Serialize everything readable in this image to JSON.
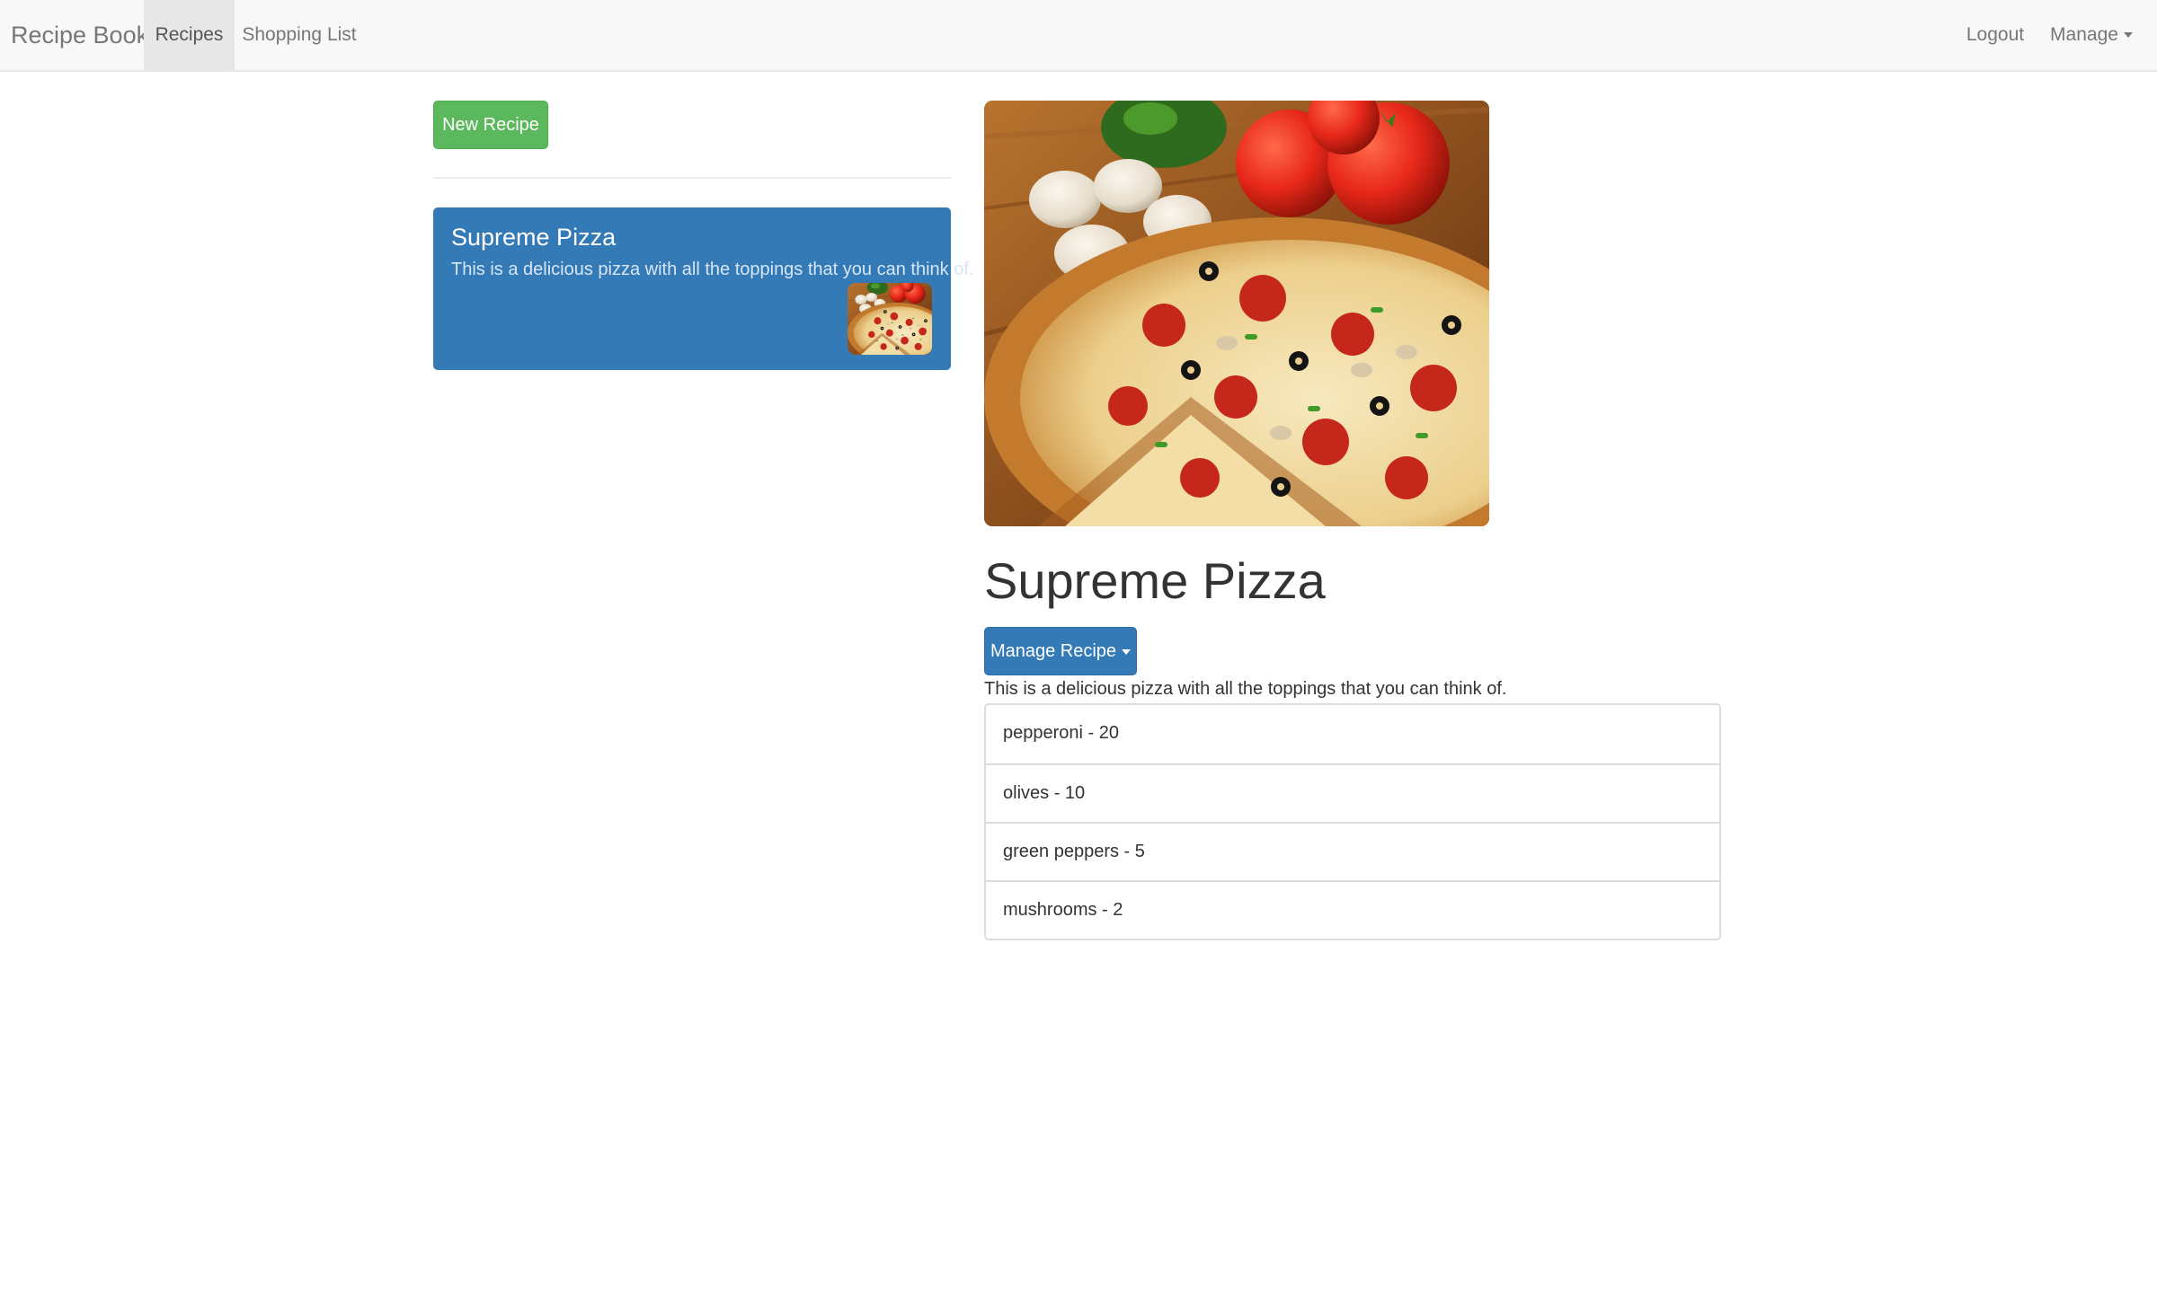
{
  "navbar": {
    "brand": "Recipe Book",
    "links": [
      "Recipes",
      "Shopping List"
    ],
    "active_link": "Recipes",
    "logout_label": "Logout",
    "manage_label": "Manage"
  },
  "sidebar": {
    "new_recipe_label": "New Recipe",
    "recipes": [
      {
        "name": "Supreme Pizza",
        "description": "This is a delicious pizza with all the toppings that you can think of.",
        "thumbnail": "pizza-photo"
      }
    ]
  },
  "detail": {
    "image": "pizza-photo",
    "title": "Supreme Pizza",
    "manage_recipe_label": "Manage Recipe",
    "description": "This is a delicious pizza with all the toppings that you can think of.",
    "ingredients": [
      "pepperoni - 20",
      "olives - 10",
      "green peppers - 5",
      "mushrooms - 2"
    ]
  },
  "colors": {
    "success": "#5cb85c",
    "primary": "#337ab7",
    "navbar_bg": "#f8f8f8"
  }
}
